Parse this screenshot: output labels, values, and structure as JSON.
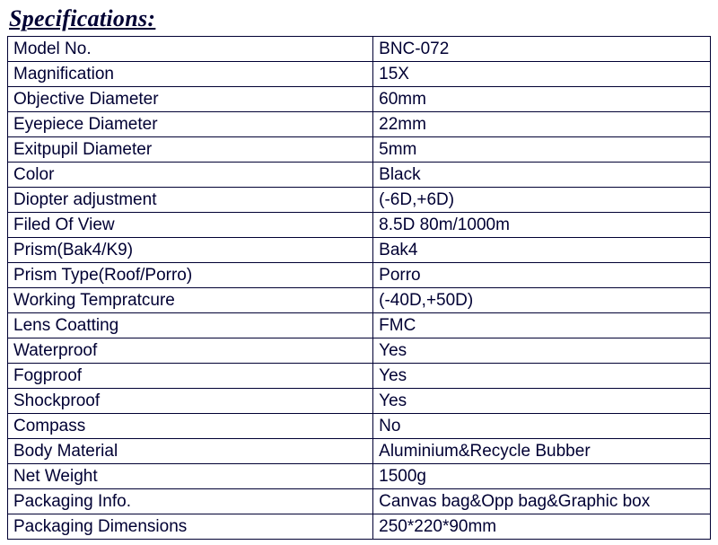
{
  "title": "Specifications:",
  "rows": [
    {
      "label": "Model No.",
      "value": "BNC-072"
    },
    {
      "label": "Magnification",
      "value": "15X"
    },
    {
      "label": "Objective Diameter",
      "value": "60mm"
    },
    {
      "label": "Eyepiece Diameter",
      "value": "22mm"
    },
    {
      "label": "Exitpupil Diameter",
      "value": "5mm"
    },
    {
      "label": "Color",
      "value": "Black"
    },
    {
      "label": "Diopter adjustment",
      "value": "(-6D,+6D)"
    },
    {
      "label": "Filed Of View",
      "value": "8.5D  80m/1000m"
    },
    {
      "label": "Prism(Bak4/K9)",
      "value": "Bak4"
    },
    {
      "label": "Prism Type(Roof/Porro)",
      "value": "Porro"
    },
    {
      "label": "Working Tempratcure",
      "value": "(-40D,+50D)"
    },
    {
      "label": "Lens Coatting",
      "value": "FMC"
    },
    {
      "label": "Waterproof",
      "value": "Yes"
    },
    {
      "label": "Fogproof",
      "value": "Yes"
    },
    {
      "label": "Shockproof",
      "value": "Yes"
    },
    {
      "label": "Compass",
      "value": "No"
    },
    {
      "label": "Body Material",
      "value": "Aluminium&Recycle Bubber"
    },
    {
      "label": "Net Weight",
      "value": "1500g"
    },
    {
      "label": "Packaging Info.",
      "value": "Canvas bag&Opp bag&Graphic box"
    },
    {
      "label": "Packaging Dimensions",
      "value": "250*220*90mm"
    }
  ]
}
